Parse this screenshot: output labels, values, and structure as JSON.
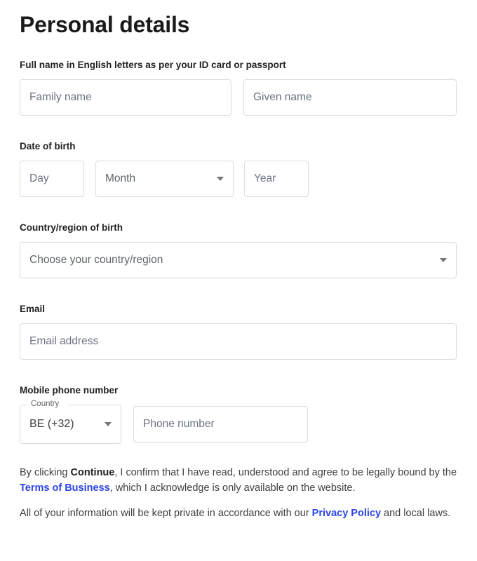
{
  "page": {
    "title": "Personal details"
  },
  "name_section": {
    "label": "Full name in English letters as per your ID card or passport",
    "family_placeholder": "Family name",
    "family_value": "",
    "given_placeholder": "Given name",
    "given_value": ""
  },
  "dob_section": {
    "label": "Date of birth",
    "day_placeholder": "Day",
    "day_value": "",
    "month_placeholder": "Month",
    "year_placeholder": "Year",
    "year_value": ""
  },
  "country_birth_section": {
    "label": "Country/region of birth",
    "placeholder": "Choose your country/region"
  },
  "email_section": {
    "label": "Email",
    "placeholder": "Email address",
    "value": ""
  },
  "phone_section": {
    "label": "Mobile phone number",
    "country_label": "Country",
    "country_value": "BE (+32)",
    "number_placeholder": "Phone number",
    "number_value": ""
  },
  "legal": {
    "line1_a": "By clicking ",
    "line1_bold": "Continue",
    "line1_b": ", I confirm that I have read, understood and agree to be legally bound by the ",
    "line1_link": "Terms of Business",
    "line1_c": ", which I acknowledge is only available on the website.",
    "line2_a": "All of your information will be kept private in accordance with our ",
    "line2_link": "Privacy Policy",
    "line2_b": " and local laws."
  },
  "icons": {
    "dropdown_caret": "chevron-down-icon"
  },
  "colors": {
    "link": "#2b44e8",
    "border": "#dadce0",
    "placeholder": "#6b7280",
    "text": "#202124"
  }
}
